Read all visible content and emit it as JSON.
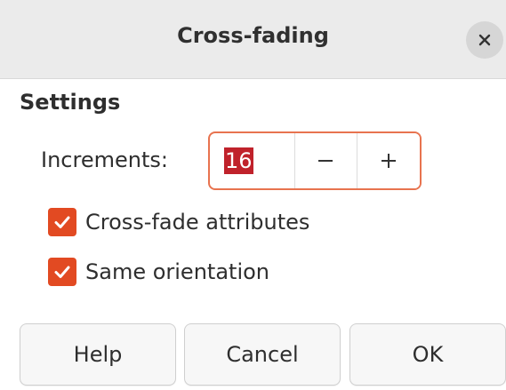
{
  "dialog": {
    "title": "Cross-fading",
    "close_icon": "close-icon"
  },
  "settings": {
    "heading": "Settings",
    "increments_label": "Increments:",
    "increments_value": "16",
    "decrement_icon": "minus-icon",
    "increment_icon": "plus-icon"
  },
  "options": [
    {
      "label": "Cross-fade attributes",
      "checked": true
    },
    {
      "label": "Same orientation",
      "checked": true
    }
  ],
  "buttons": {
    "help": "Help",
    "cancel": "Cancel",
    "ok": "OK"
  },
  "colors": {
    "accent": "#e24a22",
    "focus_border": "#e8734f",
    "selection": "#c0222b",
    "titlebar": "#ebebeb"
  }
}
